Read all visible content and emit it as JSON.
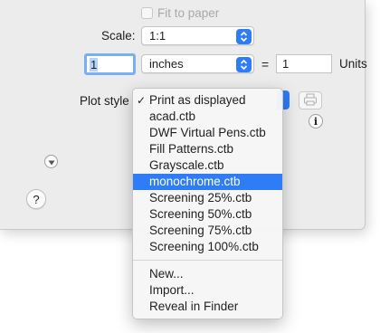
{
  "fit_to_paper": {
    "label": "Fit to paper",
    "checked": false
  },
  "scale": {
    "label": "Scale:",
    "value": "1:1"
  },
  "units_row": {
    "left_value": "1",
    "unit_select": "inches",
    "equals": "=",
    "right_value": "1",
    "units_label": "Units"
  },
  "plot_style": {
    "label": "Plot style",
    "menu": {
      "items": [
        {
          "label": "Print as displayed",
          "checked": true
        },
        {
          "label": "acad.ctb"
        },
        {
          "label": "DWF Virtual Pens.ctb"
        },
        {
          "label": "Fill Patterns.ctb"
        },
        {
          "label": "Grayscale.ctb"
        },
        {
          "label": "monochrome.ctb",
          "highlighted": true
        },
        {
          "label": "Screening 25%.ctb"
        },
        {
          "label": "Screening 50%.ctb"
        },
        {
          "label": "Screening 75%.ctb"
        },
        {
          "label": "Screening 100%.ctb"
        }
      ],
      "actions": [
        {
          "label": "New..."
        },
        {
          "label": "Import..."
        },
        {
          "label": "Reveal in Finder"
        }
      ]
    }
  },
  "icons": {
    "checkmark": "✓",
    "info": "i",
    "help": "?",
    "disclosure": "chevron-down-icon",
    "edit": "printer-edit-icon"
  },
  "colors": {
    "accent": "#2f7df6",
    "highlight": "#2f7df6"
  }
}
